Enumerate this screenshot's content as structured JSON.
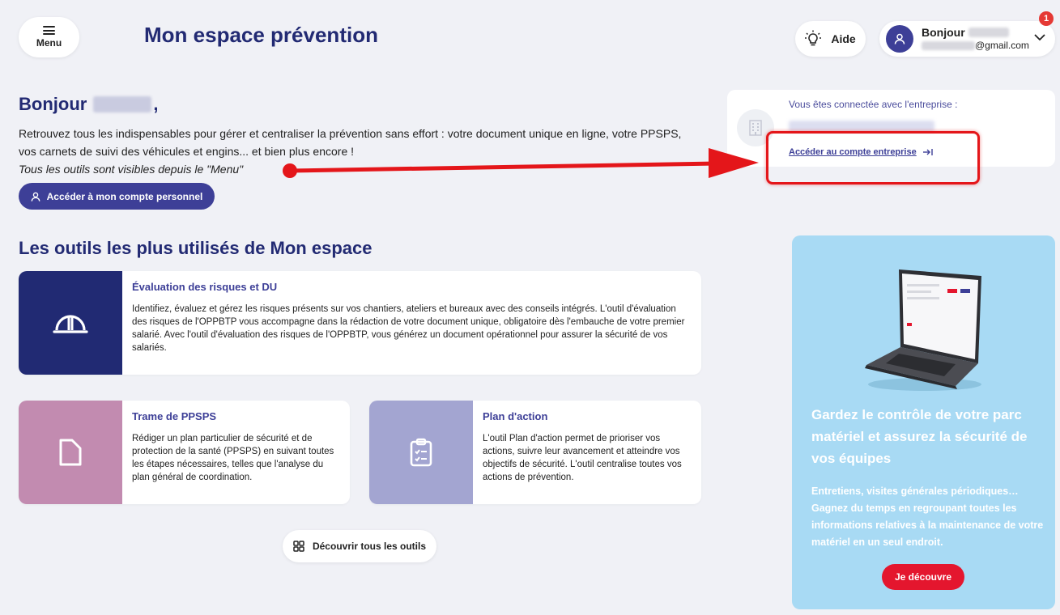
{
  "header": {
    "menu_label": "Menu",
    "app_title": "Mon espace prévention",
    "help_label": "Aide",
    "user": {
      "greeting": "Bonjour",
      "email_suffix": "@gmail.com",
      "notification_count": "1"
    }
  },
  "welcome": {
    "greeting": "Bonjour",
    "greeting_suffix": ",",
    "intro_line1": "Retrouvez tous les indispensables pour gérer et centraliser la prévention sans effort : votre document unique en ligne, votre PPSPS, vos carnets de suivi des véhicules et engins... et bien plus encore !",
    "intro_hint": "Tous les outils sont visibles depuis le \"Menu\"",
    "personal_account_button": "Accéder à mon compte personnel"
  },
  "company": {
    "connected_label": "Vous êtes connectée avec l'entreprise :",
    "company_link": "Accéder au compte entreprise"
  },
  "tools": {
    "section_title": "Les outils les plus utilisés de Mon espace",
    "items": [
      {
        "title": "Évaluation des risques et DU",
        "icon": "hard-hat-icon",
        "description": "Identifiez, évaluez et gérez les risques présents sur vos chantiers, ateliers et bureaux avec des conseils intégrés. L'outil d'évaluation des risques de l'OPPBTP vous accompagne dans la rédaction de votre document unique, obligatoire dès l'embauche de votre premier salarié. Avec l'outil d'évaluation des risques de l'OPPBTP, vous générez un document opérationnel pour assurer la sécurité de vos salariés."
      },
      {
        "title": "Trame de PPSPS",
        "icon": "document-icon",
        "description": "Rédiger un plan particulier de sécurité et de protection de la santé (PPSPS) en suivant toutes les étapes nécessaires, telles que l'analyse du plan général de coordination."
      },
      {
        "title": "Plan d'action",
        "icon": "checklist-icon",
        "description": "L'outil Plan d'action permet de prioriser vos actions, suivre leur avancement et atteindre vos objectifs de sécurité. L'outil centralise toutes vos actions de prévention."
      }
    ],
    "discover_button": "Découvrir tous les outils"
  },
  "promo": {
    "title": "Gardez le contrôle de votre parc matériel et assurez la sécurité de vos équipes",
    "text": "Entretiens, visites générales périodiques… Gagnez du temps en regroupant toutes les informations relatives à la maintenance de votre matériel en un seul endroit.",
    "button": "Je découvre"
  },
  "colors": {
    "navy": "#222a73",
    "primary": "#3d3f97",
    "accent_red": "#e4162e",
    "promo_bg": "#a8daf4",
    "ppsps_bg": "#c28bb0",
    "plan_bg": "#a3a5d1"
  }
}
